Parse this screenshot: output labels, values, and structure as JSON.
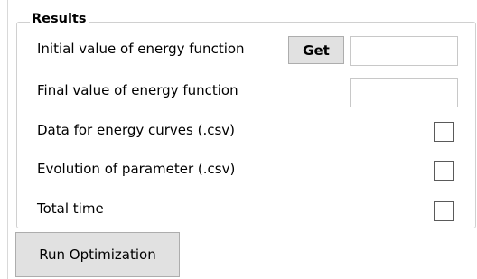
{
  "results": {
    "title": "Results",
    "initial_energy": {
      "label": "Initial value of energy function",
      "button_label": "Get",
      "value": ""
    },
    "final_energy": {
      "label": "Final value of energy function",
      "value": ""
    },
    "energy_curves": {
      "label": "Data for energy curves (.csv)",
      "checked": false
    },
    "parameter_evolution": {
      "label": "Evolution of parameter (.csv)",
      "checked": false
    },
    "total_time": {
      "label": "Total time",
      "checked": false
    }
  },
  "actions": {
    "run_label": "Run Optimization"
  }
}
